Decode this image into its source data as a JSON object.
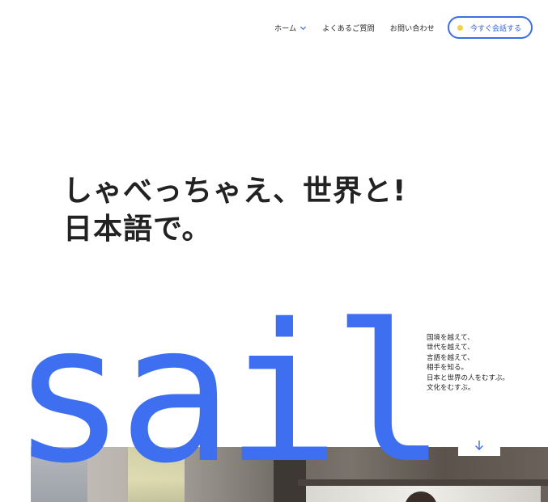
{
  "nav": {
    "items": [
      {
        "label": "ホーム",
        "has_dropdown": true
      },
      {
        "label": "よくあるご質問"
      },
      {
        "label": "お問い合わせ"
      }
    ],
    "cta_label": "今すぐ会話する"
  },
  "hero": {
    "line1": "しゃべっちゃえ、世界と!",
    "line2": "日本語で。"
  },
  "copy": {
    "lines": [
      "国境を越えて、",
      "世代を越えて、",
      "言語を越えて、",
      "相手を知る。",
      "日本と世界の人をむすぶ。",
      "文化をむすぶ。"
    ]
  },
  "brand": {
    "word": "sail",
    "accent_color": "#3d6ff0",
    "cta_dot_color": "#f2d24a"
  },
  "icons": {
    "dropdown": "chevron-down-icon",
    "scroll": "arrow-down-icon"
  }
}
